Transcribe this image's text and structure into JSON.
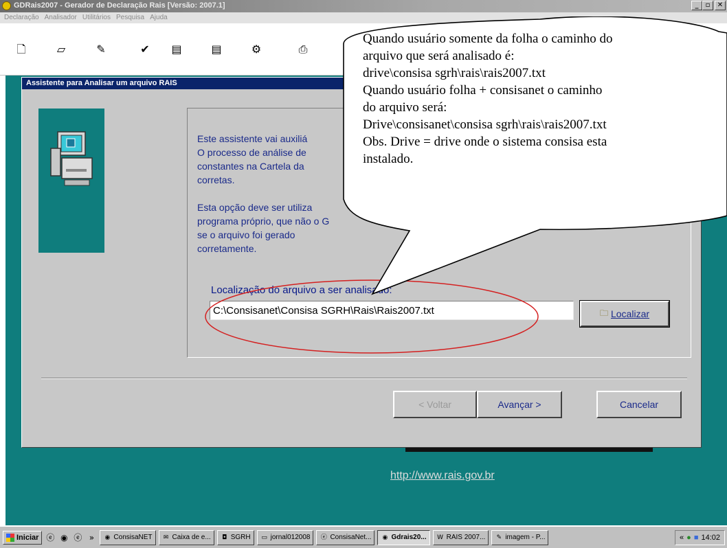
{
  "window": {
    "title": "GDRais2007 - Gerador de Declaração Rais [Versão: 2007.1]",
    "buttons": {
      "minimize": "_",
      "maximize": "▫",
      "close": "✕"
    }
  },
  "menubar": [
    "Declaração",
    "Analisador",
    "Utilitários",
    "Pesquisa",
    "Ajuda"
  ],
  "toolbar": {
    "icons": [
      "new-document-icon",
      "open-folder-icon",
      "edit-icon",
      "check-icon",
      "copy-icon",
      "paste-icon",
      "tools-icon",
      "print-icon"
    ]
  },
  "dialog": {
    "title": "Assistente para Analisar um arquivo RAIS",
    "paragraph1": "Este assistente vai auxiliá\nO processo de análise de\nconstantes na Cartela da\ncorretas.",
    "paragraph2": "Esta opção deve ser utiliza\nprograma próprio, que não o G\nse o arquivo foi gerado corretamente.",
    "path_label": "Localização do arquivo a ser analisado:",
    "path_value": "C:\\Consisanet\\Consisa SGRH\\Rais\\Rais2007.txt",
    "browse_button": "Localizar",
    "back_button": "< Voltar",
    "next_button": "Avançar >",
    "cancel_button": "Cancelar"
  },
  "website": "http://www.rais.gov.br",
  "callout": {
    "lines": [
      "Quando usuário somente da folha o caminho do",
      "arquivo que será analisado é:",
      "drive\\consisa sgrh\\rais\\rais2007.txt",
      "Quando usuário folha + consisanet o caminho",
      "do arquivo será:",
      "Drive\\consisanet\\consisa sgrh\\rais\\rais2007.txt",
      "Obs. Drive = drive onde o sistema consisa esta",
      "instalado."
    ]
  },
  "taskbar": {
    "start": "Iniciar",
    "chevron": "»",
    "tasks": [
      {
        "label": "ConsisaNET",
        "icon": "app-icon"
      },
      {
        "label": "Caixa de e...",
        "icon": "mail-icon"
      },
      {
        "label": "SGRH",
        "icon": "app-icon"
      },
      {
        "label": "jornal012008",
        "icon": "folder-icon"
      },
      {
        "label": "ConsisaNet...",
        "icon": "browser-icon"
      },
      {
        "label": "Gdrais20...",
        "icon": "app-icon",
        "active": true
      },
      {
        "label": "RAIS 2007...",
        "icon": "word-icon"
      },
      {
        "label": "imagem - P...",
        "icon": "paint-icon"
      }
    ],
    "tray_chevron": "«",
    "clock": "14:02"
  },
  "colors": {
    "desktop": "#0f7d7d",
    "dialog_title": "#0a246a",
    "annotation": "#d42020"
  }
}
